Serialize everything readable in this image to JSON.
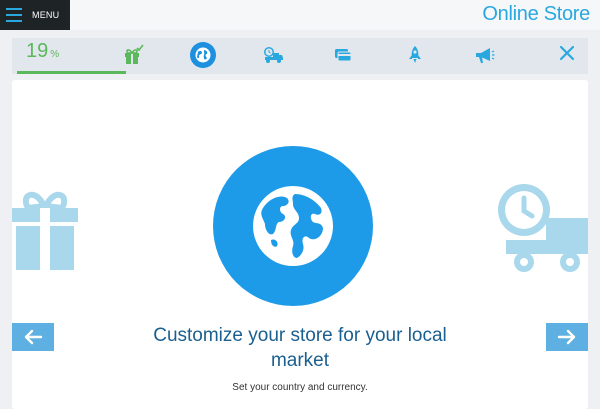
{
  "topbar": {
    "menu_label": "MENU",
    "store_title": "Online Store"
  },
  "progress": {
    "percent": 19,
    "percent_sign": "%",
    "steps": [
      {
        "name": "gift",
        "completed": true
      },
      {
        "name": "globe",
        "active": true
      },
      {
        "name": "delivery-truck"
      },
      {
        "name": "credit-card"
      },
      {
        "name": "rocket"
      },
      {
        "name": "megaphone"
      }
    ]
  },
  "main": {
    "headline": "Customize your store for your local market",
    "subtext": "Set your country and currency."
  },
  "colors": {
    "accent_blue": "#29a8e0",
    "active_blue": "#1e9be8",
    "progress_green": "#5cb85c",
    "headline_blue": "#1a5f8f",
    "menu_bg": "#1e2326"
  }
}
